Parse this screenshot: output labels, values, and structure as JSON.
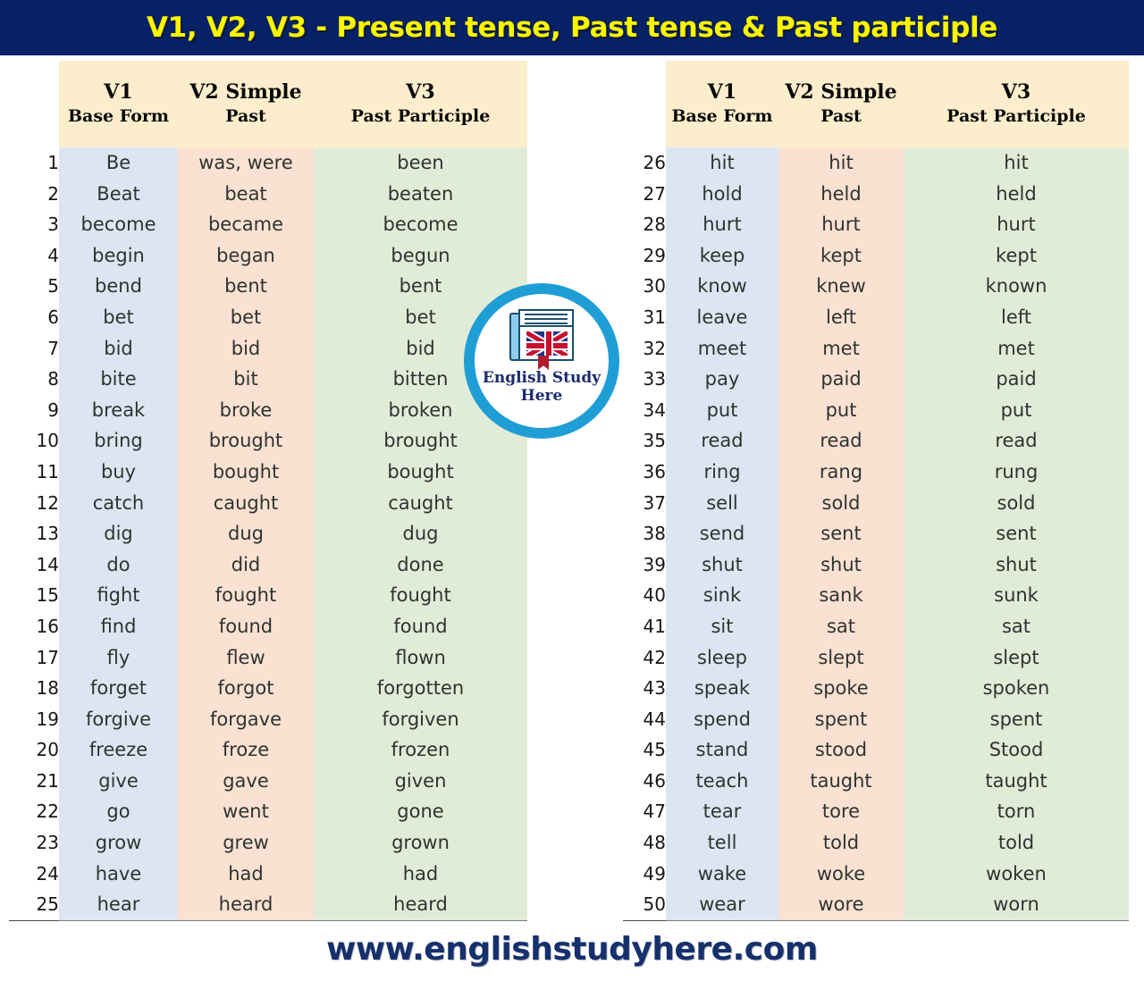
{
  "title": "V1, V2, V3 - Present tense, Past tense & Past participle",
  "theme": {
    "banner_bg": "#062166",
    "title_color": "#f9f500",
    "header_cell_bg": "#fceecc",
    "v1_col_bg": "#dce6f2",
    "v2_col_bg": "#fbe1d2",
    "v3_col_bg": "#e1ecd8",
    "footer_color": "#16306e",
    "logo_ring": "#1f9ed6"
  },
  "columns": [
    {
      "line1": "V1",
      "line2": "Base Form"
    },
    {
      "line1": "V2 Simple",
      "line2": "Past"
    },
    {
      "line1": "V3",
      "line2": "Past Participle"
    }
  ],
  "logo": {
    "line1": "English Study",
    "line2": "Here"
  },
  "footer": {
    "url": "www.englishstudyhere.com"
  },
  "chart_data": {
    "type": "table",
    "title": "V1, V2, V3 - Present tense, Past tense & Past participle",
    "columns": [
      "#",
      "V1 Base Form",
      "V2 Simple Past",
      "V3 Past Participle"
    ]
  },
  "left_table": [
    {
      "n": "1",
      "v1": "Be",
      "v2": "was, were",
      "v3": "been"
    },
    {
      "n": "2",
      "v1": "Beat",
      "v2": "beat",
      "v3": "beaten"
    },
    {
      "n": "3",
      "v1": "become",
      "v2": "became",
      "v3": "become"
    },
    {
      "n": "4",
      "v1": "begin",
      "v2": "began",
      "v3": "begun"
    },
    {
      "n": "5",
      "v1": "bend",
      "v2": "bent",
      "v3": "bent"
    },
    {
      "n": "6",
      "v1": "bet",
      "v2": "bet",
      "v3": "bet"
    },
    {
      "n": "7",
      "v1": "bid",
      "v2": "bid",
      "v3": "bid"
    },
    {
      "n": "8",
      "v1": "bite",
      "v2": "bit",
      "v3": "bitten"
    },
    {
      "n": "9",
      "v1": "break",
      "v2": "broke",
      "v3": "broken"
    },
    {
      "n": "10",
      "v1": "bring",
      "v2": "brought",
      "v3": "brought"
    },
    {
      "n": "11",
      "v1": "buy",
      "v2": "bought",
      "v3": "bought"
    },
    {
      "n": "12",
      "v1": "catch",
      "v2": "caught",
      "v3": "caught"
    },
    {
      "n": "13",
      "v1": "dig",
      "v2": "dug",
      "v3": "dug"
    },
    {
      "n": "14",
      "v1": "do",
      "v2": "did",
      "v3": "done"
    },
    {
      "n": "15",
      "v1": "fight",
      "v2": "fought",
      "v3": "fought"
    },
    {
      "n": "16",
      "v1": "find",
      "v2": "found",
      "v3": "found"
    },
    {
      "n": "17",
      "v1": "fly",
      "v2": "flew",
      "v3": "flown"
    },
    {
      "n": "18",
      "v1": "forget",
      "v2": "forgot",
      "v3": "forgotten"
    },
    {
      "n": "19",
      "v1": "forgive",
      "v2": "forgave",
      "v3": "forgiven"
    },
    {
      "n": "20",
      "v1": "freeze",
      "v2": "froze",
      "v3": "frozen"
    },
    {
      "n": "21",
      "v1": "give",
      "v2": "gave",
      "v3": "given"
    },
    {
      "n": "22",
      "v1": "go",
      "v2": "went",
      "v3": "gone"
    },
    {
      "n": "23",
      "v1": "grow",
      "v2": "grew",
      "v3": "grown"
    },
    {
      "n": "24",
      "v1": "have",
      "v2": "had",
      "v3": "had"
    },
    {
      "n": "25",
      "v1": "hear",
      "v2": "heard",
      "v3": "heard"
    }
  ],
  "right_table": [
    {
      "n": "26",
      "v1": "hit",
      "v2": "hit",
      "v3": "hit"
    },
    {
      "n": "27",
      "v1": "hold",
      "v2": "held",
      "v3": "held"
    },
    {
      "n": "28",
      "v1": "hurt",
      "v2": "hurt",
      "v3": "hurt"
    },
    {
      "n": "29",
      "v1": "keep",
      "v2": "kept",
      "v3": "kept"
    },
    {
      "n": "30",
      "v1": "know",
      "v2": "knew",
      "v3": "known"
    },
    {
      "n": "31",
      "v1": "leave",
      "v2": "left",
      "v3": "left"
    },
    {
      "n": "32",
      "v1": "meet",
      "v2": "met",
      "v3": "met"
    },
    {
      "n": "33",
      "v1": "pay",
      "v2": "paid",
      "v3": "paid"
    },
    {
      "n": "34",
      "v1": "put",
      "v2": "put",
      "v3": "put"
    },
    {
      "n": "35",
      "v1": "read",
      "v2": "read",
      "v3": "read"
    },
    {
      "n": "36",
      "v1": "ring",
      "v2": "rang",
      "v3": "rung"
    },
    {
      "n": "37",
      "v1": "sell",
      "v2": "sold",
      "v3": "sold"
    },
    {
      "n": "38",
      "v1": "send",
      "v2": "sent",
      "v3": "sent"
    },
    {
      "n": "39",
      "v1": "shut",
      "v2": "shut",
      "v3": "shut"
    },
    {
      "n": "40",
      "v1": "sink",
      "v2": "sank",
      "v3": "sunk"
    },
    {
      "n": "41",
      "v1": "sit",
      "v2": "sat",
      "v3": "sat"
    },
    {
      "n": "42",
      "v1": "sleep",
      "v2": "slept",
      "v3": "slept"
    },
    {
      "n": "43",
      "v1": "speak",
      "v2": "spoke",
      "v3": "spoken"
    },
    {
      "n": "44",
      "v1": "spend",
      "v2": "spent",
      "v3": "spent"
    },
    {
      "n": "45",
      "v1": "stand",
      "v2": "stood",
      "v3": "Stood"
    },
    {
      "n": "46",
      "v1": "teach",
      "v2": "taught",
      "v3": "taught"
    },
    {
      "n": "47",
      "v1": "tear",
      "v2": "tore",
      "v3": "torn"
    },
    {
      "n": "48",
      "v1": "tell",
      "v2": "told",
      "v3": "told"
    },
    {
      "n": "49",
      "v1": "wake",
      "v2": "woke",
      "v3": "woken"
    },
    {
      "n": "50",
      "v1": "wear",
      "v2": "wore",
      "v3": "worn"
    }
  ]
}
